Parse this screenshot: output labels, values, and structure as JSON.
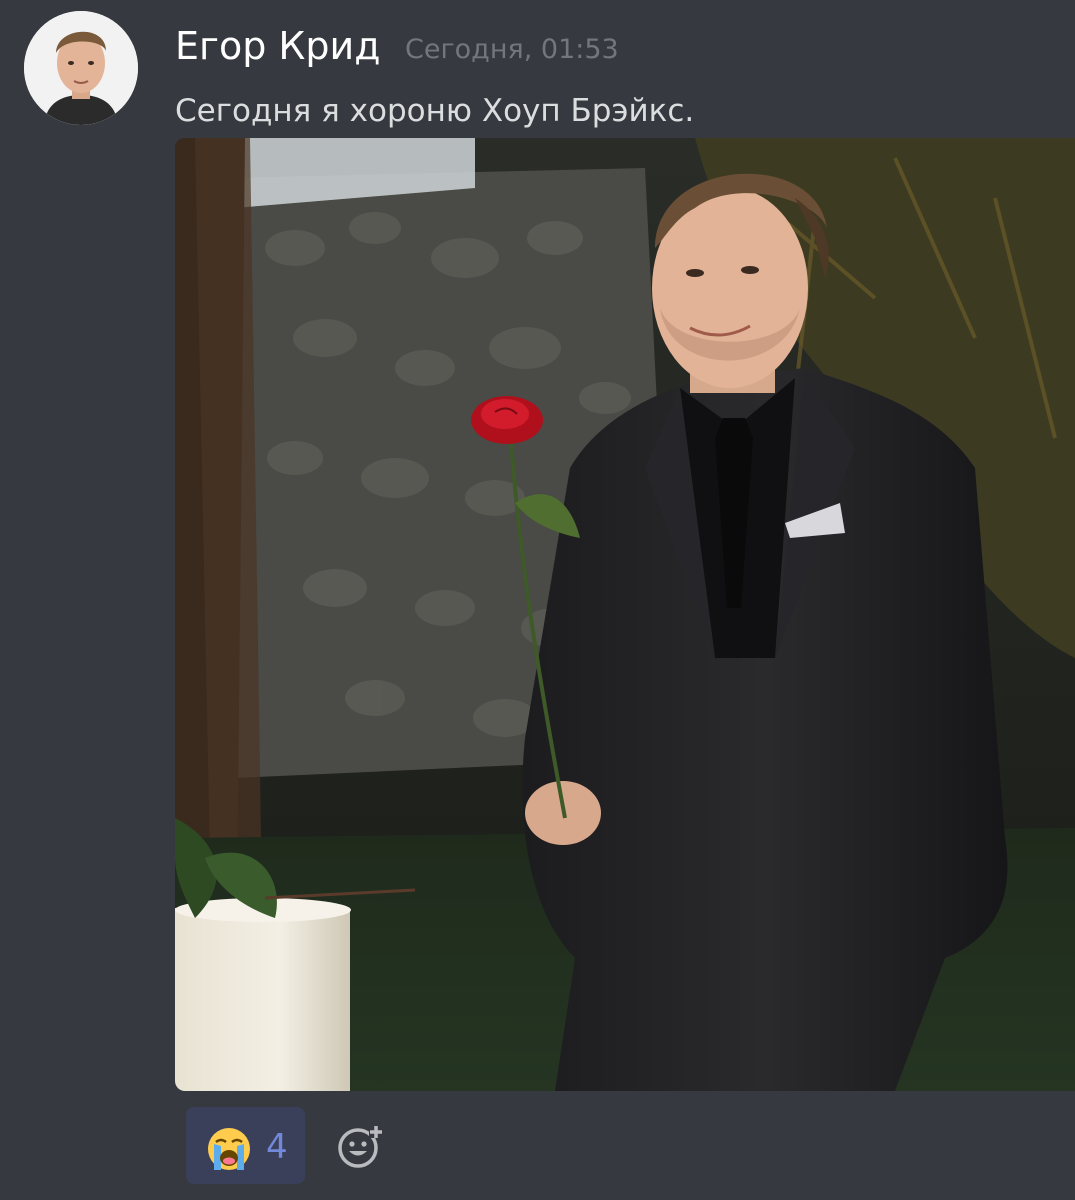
{
  "message": {
    "author": "Егор Крид",
    "timestamp": "Сегодня, 01:53",
    "content": "Сегодня я хороню Хоуп Брэйкс."
  },
  "attachment": {
    "type": "image"
  },
  "reactions": [
    {
      "emoji": "loudly-crying-face-icon",
      "count": "4",
      "active": true
    }
  ],
  "icons": {
    "add_reaction": "add-reaction-icon"
  },
  "colors": {
    "background": "#36393f",
    "author": "#ffffff",
    "timestamp": "#72767d",
    "text": "#dcddde",
    "reaction_bg": "#3b405a",
    "reaction_count": "#7289da"
  }
}
